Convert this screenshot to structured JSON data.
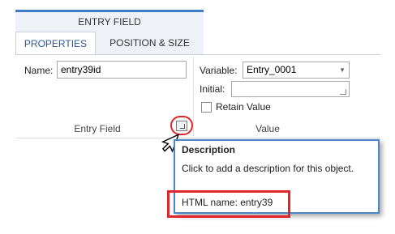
{
  "ribbon": {
    "title": "ENTRY FIELD",
    "tabs": [
      "PROPERTIES",
      "POSITION & SIZE"
    ]
  },
  "entry_field_group": {
    "name_label": "Name:",
    "name_value": "entry39id",
    "caption": "Entry Field",
    "launcher_icon": "dialog-launcher-icon"
  },
  "value_group": {
    "variable_label": "Variable:",
    "variable_value": "Entry_0001",
    "initial_label": "Initial:",
    "initial_value": "",
    "retain_label": "Retain Value",
    "retain_checked": false,
    "caption": "Value"
  },
  "tooltip": {
    "title": "Description",
    "body": "Click to add a description for this object.",
    "html_name": "HTML name: entry39"
  },
  "colors": {
    "accent": "#3d7cc9",
    "highlight": "#e3242b",
    "tooltip_border": "#4a86c8"
  }
}
